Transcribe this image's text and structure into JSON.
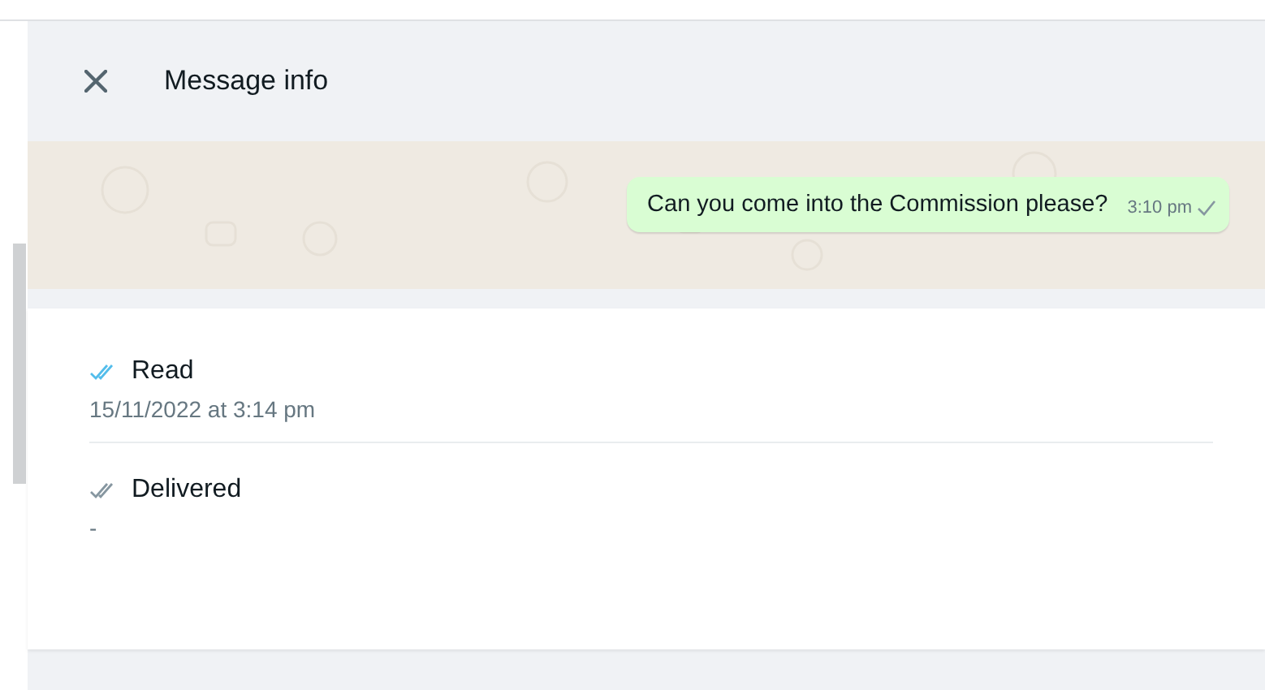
{
  "header": {
    "title": "Message info"
  },
  "message": {
    "text": "Can you come into the Commission please?",
    "time": "3:10 pm",
    "delivered": false
  },
  "receipts": [
    {
      "kind": "read",
      "label": "Read",
      "time": "15/11/2022 at 3:14 pm"
    },
    {
      "kind": "delivered",
      "label": "Delivered",
      "time": "-"
    }
  ]
}
